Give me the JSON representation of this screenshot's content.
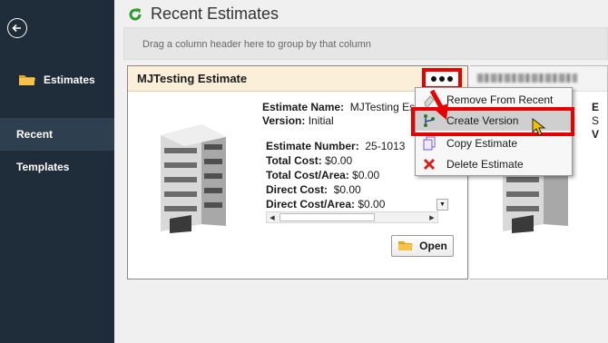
{
  "sidebar": {
    "back_icon": "back-arrow-icon",
    "estimates_label": "Estimates",
    "recent_label": "Recent",
    "templates_label": "Templates"
  },
  "header": {
    "title": "Recent Estimates",
    "icon": "refresh-icon"
  },
  "group_bar": {
    "text": "Drag a column header here to group by that column"
  },
  "card": {
    "title": "MJTesting Estimate",
    "estimate_name_label": "Estimate Name:",
    "estimate_name_value": "MJTesting Est",
    "version_label": "Version:",
    "version_value": "Initial",
    "estimate_number_label": "Estimate Number:",
    "estimate_number_value": "25-1013",
    "total_cost_label": "Total Cost:",
    "total_cost_value": "$0.00",
    "total_cost_area_label": "Total Cost/Area:",
    "total_cost_area_value": "$0.00",
    "direct_cost_label": "Direct Cost:",
    "direct_cost_value": "$0.00",
    "direct_cost_area_label": "Direct Cost/Area:",
    "direct_cost_area_value": "$0.00",
    "open_label": "Open"
  },
  "card2": {
    "partial_1": "E",
    "partial_2": "S",
    "partial_3": "V"
  },
  "context_menu": {
    "items": [
      {
        "label": "Remove From Recent",
        "icon": "eraser-icon"
      },
      {
        "label": "Create Version",
        "icon": "version-branch-icon"
      },
      {
        "label": "Copy Estimate",
        "icon": "copy-icon"
      },
      {
        "label": "Delete Estimate",
        "icon": "delete-x-icon"
      }
    ]
  },
  "colors": {
    "sidebar_bg": "#1f2d3a",
    "sidebar_selected": "#2e3f50",
    "card_header_bg": "#fbefd9",
    "annotation_red": "#e60000"
  }
}
